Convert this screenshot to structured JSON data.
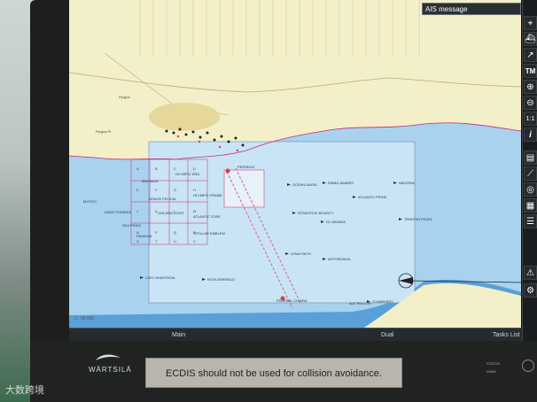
{
  "ais_header": {
    "label": "AIS message"
  },
  "toolbar": {
    "icons": [
      "satellite-icon",
      "ship-icon",
      "route-icon",
      "tm-label",
      "zoom-in-icon",
      "zoom-out-icon",
      "scale-1-1-icon",
      "info-icon",
      "layers-icon",
      "measure-icon",
      "target-icon",
      "grid-icon",
      "menu-icon",
      "alarm-icon",
      "settings-icon"
    ],
    "tm_label": "TM",
    "scale_label": "1:1",
    "info_label": "i"
  },
  "statusbar": {
    "main_label": "Main",
    "dual_label": "Dual",
    "tasks_label": "Tasks List"
  },
  "chart": {
    "scale_text": "1 : 50 000",
    "place_labels": [
      "Pyrgos",
      "Pyrgos Pt"
    ],
    "ship_labels": [
      "OCEAN ANGEL",
      "EMMA JAVARIS",
      "NAVIORA",
      "ATLANTIC PRIDE",
      "STRATEGIC BOUNTY",
      "OLYMPIC FRAME",
      "DL NAVARA",
      "TRINITAS PEARL",
      "LENA FAITH",
      "AFFORDAVIA",
      "LADY ANASTASIA",
      "NOTA EMERALD",
      "ALE PALCON",
      "TI HARVEST",
      "FEDERAL CHIARA",
      "ANDE PHOENIX",
      "GOLDEN LIGHT",
      "ATLANTIC STAR",
      "STELLAR EMBLEM",
      "OLYMPIC ERA",
      "PANAGIA",
      "MAXIMUS",
      "MYSTIC",
      "PERSEUS",
      "GRACE FELICIA",
      "SEA PRIDE"
    ],
    "grid_letters": [
      "A",
      "B",
      "C",
      "D",
      "E",
      "F",
      "G",
      "H",
      "J",
      "K",
      "L",
      "M",
      "N",
      "P",
      "Q",
      "R",
      "S",
      "T",
      "U",
      "V"
    ]
  },
  "warning": {
    "text": "ECDIS should not be used for collision avoidance."
  },
  "bezel": {
    "brand": "WÄRTSILÄ",
    "status_label": "STATUS",
    "dimmer_label": "DIMM"
  },
  "watermark": {
    "text": "大数跨境"
  },
  "colors": {
    "land": "#f3efc9",
    "deep_water": "#5aa0d8",
    "shallow_water": "#a9d2ef",
    "anchorage": "#c9e4f5",
    "coast_pink": "#c2297a",
    "traffic_lane": "#d95b9b"
  }
}
